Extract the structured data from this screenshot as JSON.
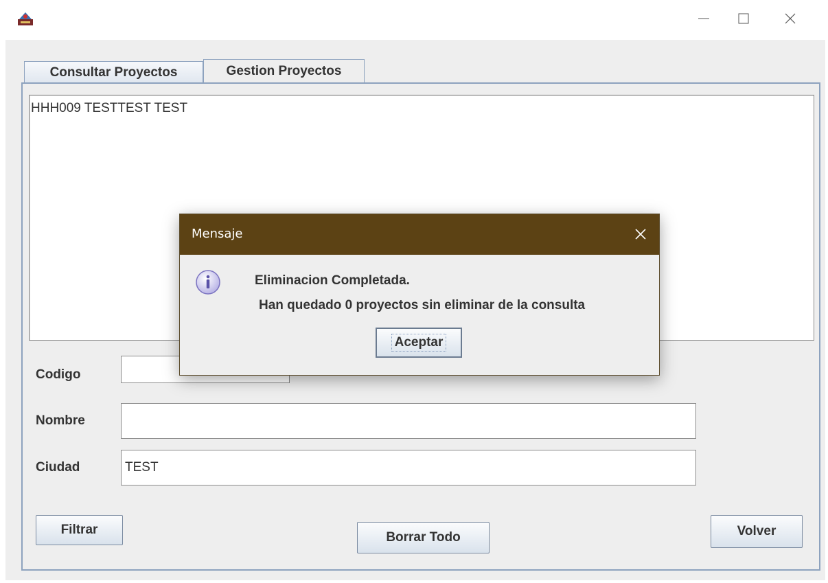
{
  "window": {
    "controls": {
      "minimize_icon": "minimize-icon",
      "maximize_icon": "maximize-icon",
      "close_icon": "close-icon"
    }
  },
  "tabs": [
    {
      "label": "Consultar Proyectos",
      "active": true
    },
    {
      "label": "Gestion Proyectos",
      "active": false
    }
  ],
  "results": {
    "text": "HHH009 TESTTEST TEST"
  },
  "form": {
    "codigo": {
      "label": "Codigo",
      "value": ""
    },
    "nombre": {
      "label": "Nombre",
      "value": ""
    },
    "ciudad": {
      "label": "Ciudad",
      "value": "TEST"
    }
  },
  "buttons": {
    "filtrar": "Filtrar",
    "borrar_todo": "Borrar Todo",
    "volver": "Volver"
  },
  "dialog": {
    "title": "Mensaje",
    "line1": "Eliminacion Completada.",
    "line2": "Han quedado 0 proyectos sin eliminar de la consulta",
    "ok_label": "Aceptar",
    "icon": "info-icon"
  },
  "colors": {
    "dialog_titlebar": "#5c4214",
    "tab_border": "#8da2be",
    "client_bg": "#eeeeee"
  }
}
